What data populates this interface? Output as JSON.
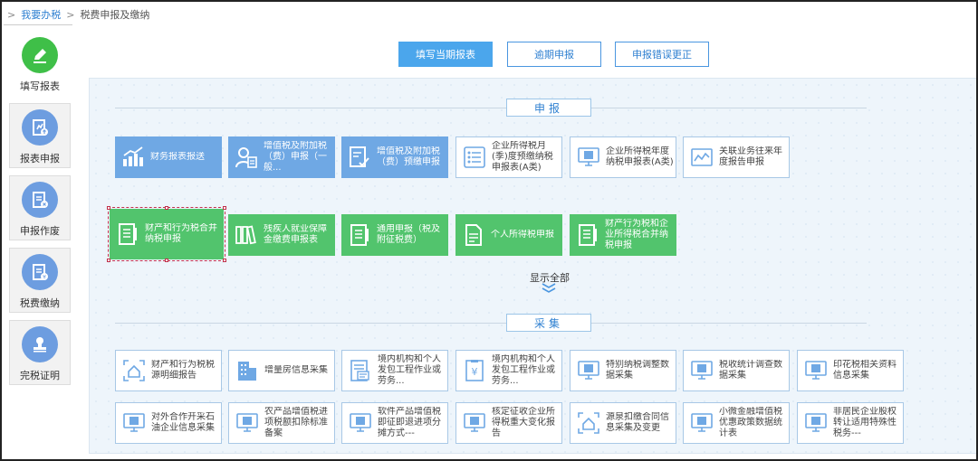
{
  "breadcrumb": {
    "prefix": ">",
    "link": "我要办税",
    "sep": ">",
    "current": "税费申报及缴纳"
  },
  "sidebar": {
    "items": [
      {
        "label": "填写报表",
        "icon": "pencil-icon",
        "active": true
      },
      {
        "label": "报表申报",
        "icon": "upload-report-icon",
        "active": false
      },
      {
        "label": "申报作废",
        "icon": "void-report-icon",
        "active": false
      },
      {
        "label": "税费缴纳",
        "icon": "tax-payment-icon",
        "active": false
      },
      {
        "label": "完税证明",
        "icon": "stamp-icon",
        "active": false
      }
    ]
  },
  "tabs": [
    {
      "label": "填写当期报表",
      "active": true
    },
    {
      "label": "逾期申报",
      "active": false
    },
    {
      "label": "申报错误更正",
      "active": false
    }
  ],
  "sections": {
    "declare": {
      "title": "申报"
    },
    "collect": {
      "title": "采集"
    }
  },
  "declare_cards_row1": [
    {
      "label": "财务报表报送",
      "style": "blue",
      "icon": "bar-chart-icon"
    },
    {
      "label": "增值税及附加税（费）申报（一般...",
      "style": "blue",
      "icon": "person-doc-icon"
    },
    {
      "label": "增值税及附加税（费）预缴申报",
      "style": "blue",
      "icon": "doc-check-icon"
    },
    {
      "label": "企业所得税月(季)度预缴纳税申报表(A类)",
      "style": "white",
      "icon": "list-icon"
    },
    {
      "label": "企业所得税年度纳税申报表(A类)",
      "style": "white",
      "icon": "monitor-icon"
    },
    {
      "label": "关联业务往来年度报告申报",
      "style": "white",
      "icon": "trend-icon"
    }
  ],
  "declare_cards_row2": [
    {
      "label": "财产和行为税合并纳税申报",
      "style": "green",
      "icon": "document-icon"
    },
    {
      "label": "残疾人就业保障金缴费申报表",
      "style": "green",
      "icon": "binders-icon"
    },
    {
      "label": "通用申报（税及附征税费）",
      "style": "green",
      "icon": "document-icon"
    },
    {
      "label": "个人所得税申报",
      "style": "green",
      "icon": "file-icon"
    },
    {
      "label": "财产行为税和企业所得税合并纳税申报",
      "style": "green",
      "icon": "document-icon"
    }
  ],
  "show_all": "显示全部",
  "collect_cards_row1": [
    {
      "label": "财产和行为税税源明细报告",
      "icon": "house-scan-icon"
    },
    {
      "label": "增量房信息采集",
      "icon": "building-icon"
    },
    {
      "label": "境内机构和个人发包工程作业或劳务...",
      "icon": "doc-form-icon"
    },
    {
      "label": "境内机构和个人发包工程作业或劳务...",
      "icon": "yen-doc-icon"
    },
    {
      "label": "特别纳税调整数据采集",
      "icon": "monitor-icon"
    },
    {
      "label": "税收统计调查数据采集",
      "icon": "monitor-icon"
    },
    {
      "label": "印花税相关资料信息采集",
      "icon": "monitor-icon"
    }
  ],
  "collect_cards_row2": [
    {
      "label": "对外合作开采石油企业信息采集",
      "icon": "monitor-icon"
    },
    {
      "label": "农产品增值税进项税额扣除标准备案",
      "icon": "monitor-icon"
    },
    {
      "label": "软件产品增值税即征即退进项分摊方式---",
      "icon": "monitor-icon"
    },
    {
      "label": "核定征收企业所得税重大变化报告",
      "icon": "monitor-icon"
    },
    {
      "label": "源泉扣缴合同信息采集及变更",
      "icon": "house-scan-icon"
    },
    {
      "label": "小微金融增值税优惠政策数据统计表",
      "icon": "monitor-icon"
    },
    {
      "label": "非居民企业股权转让适用特殊性税务---",
      "icon": "monitor-icon"
    }
  ],
  "colors": {
    "blue_card": "#6fa8e4",
    "green_card": "#52c46d",
    "accent": "#2f80d1",
    "active_tab": "#4ba6ec",
    "selection": "#c0304a"
  }
}
